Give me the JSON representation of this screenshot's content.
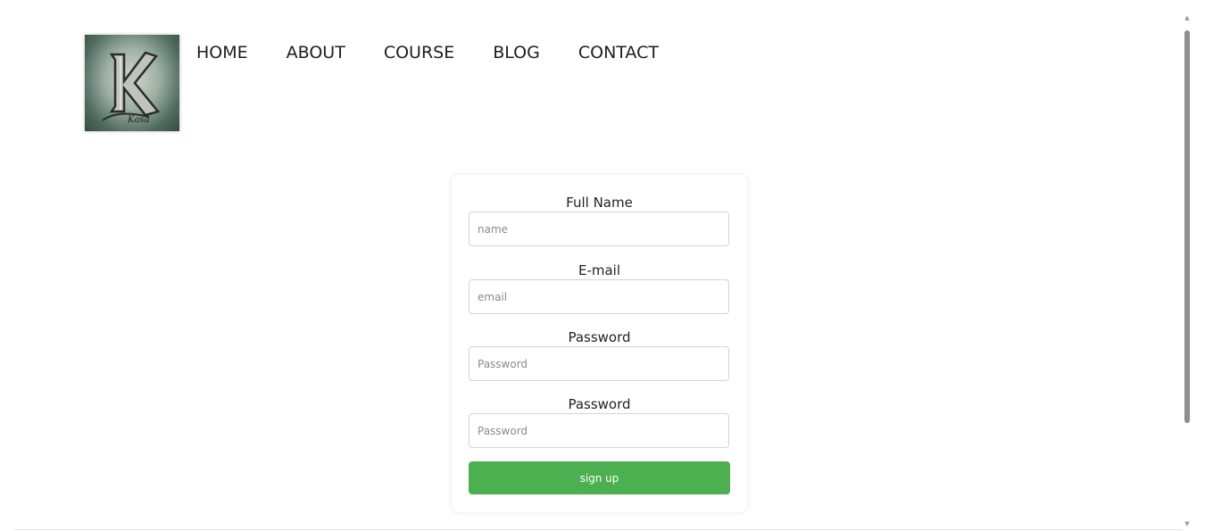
{
  "logo": {
    "letter": "K",
    "script_text": "Kasa"
  },
  "nav": {
    "items": [
      {
        "label": "HOME"
      },
      {
        "label": "ABOUT"
      },
      {
        "label": "COURSE"
      },
      {
        "label": "BLOG"
      },
      {
        "label": "CONTACT"
      }
    ]
  },
  "form": {
    "fields": [
      {
        "label": "Full Name",
        "placeholder": "name",
        "value": ""
      },
      {
        "label": "E-mail",
        "placeholder": "email",
        "value": ""
      },
      {
        "label": "Password",
        "placeholder": "Password",
        "value": ""
      },
      {
        "label": "Password",
        "placeholder": "Password",
        "value": ""
      }
    ],
    "submit_label": "sign up"
  },
  "colors": {
    "button": "#4caf50",
    "text": "#1e1e1e"
  },
  "scrollbar": {
    "up_icon": "triangle-up",
    "down_icon": "triangle-down"
  }
}
